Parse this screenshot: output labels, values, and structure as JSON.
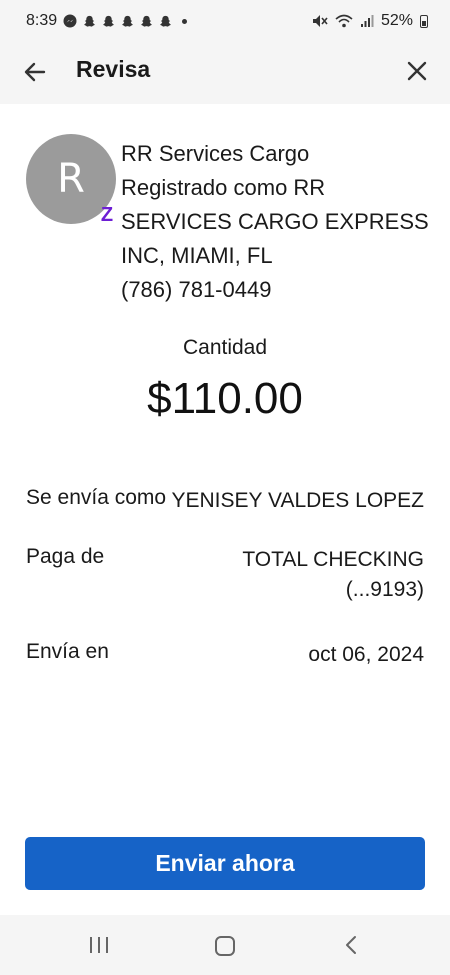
{
  "status_bar": {
    "time": "8:39",
    "battery": "52%"
  },
  "header": {
    "title": "Revisa"
  },
  "recipient": {
    "initial": "R",
    "name": "RR Services Cargo",
    "registered_line1": "Registrado como RR",
    "registered_line2": "SERVICES CARGO EXPRESS",
    "registered_line3": "INC, MIAMI, FL",
    "phone": "(786) 781-0449",
    "badge": "Z"
  },
  "amount": {
    "label": "Cantidad",
    "value": "$110.00"
  },
  "details": {
    "sent_as_label": "Se envía como",
    "sent_as_value": "YENISEY VALDES LOPEZ",
    "pay_from_label": "Paga de",
    "pay_from_value_line1": "TOTAL CHECKING",
    "pay_from_value_line2": "(...9193)",
    "send_on_label": "Envía en",
    "send_on_value": "oct 06, 2024"
  },
  "actions": {
    "send_now_label": "Enviar ahora"
  },
  "colors": {
    "primary_button": "#1663c7",
    "zelle_purple": "#6d1ed4",
    "avatar_gray": "#9b9b9b"
  }
}
